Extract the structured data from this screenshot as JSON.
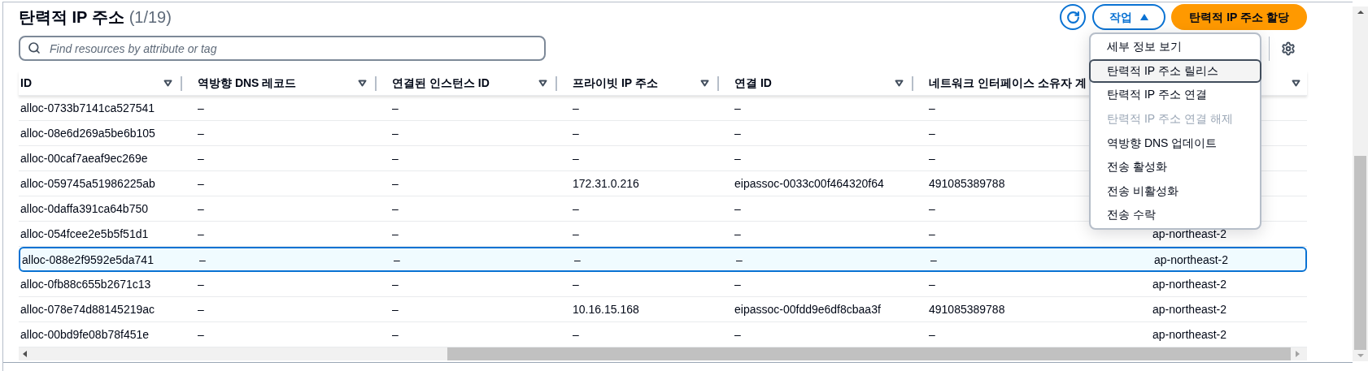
{
  "header": {
    "title": "탄력적 IP 주소",
    "count": "(1/19)"
  },
  "actions_menu": {
    "label": "작업",
    "expanded": true,
    "items": [
      {
        "label": "세부 정보 보기",
        "selected": false,
        "disabled": false
      },
      {
        "label": "탄력적 IP 주소 릴리스",
        "selected": true,
        "disabled": false
      },
      {
        "label": "탄력적 IP 주소 연결",
        "selected": false,
        "disabled": false
      },
      {
        "label": "탄력적 IP 주소 연결 해제",
        "selected": false,
        "disabled": true
      },
      {
        "label": "역방향 DNS 업데이트",
        "selected": false,
        "disabled": false
      },
      {
        "label": "전송 활성화",
        "selected": false,
        "disabled": false
      },
      {
        "label": "전송 비활성화",
        "selected": false,
        "disabled": false
      },
      {
        "label": "전송 수락",
        "selected": false,
        "disabled": false
      }
    ]
  },
  "allocate_button": "탄력적 IP 주소 할당",
  "search": {
    "placeholder": "Find resources by attribute or tag"
  },
  "table": {
    "columns": [
      {
        "label": "ID"
      },
      {
        "label": "역방향 DNS 레코드"
      },
      {
        "label": "연결된 인스턴스 ID"
      },
      {
        "label": "프라이빗 IP 주소"
      },
      {
        "label": "연결 ID"
      },
      {
        "label": "네트워크 인터페이스 소유자 계"
      }
    ],
    "rows": [
      {
        "selected": false,
        "cells": [
          "alloc-0733b7141ca527541",
          "–",
          "–",
          "–",
          "–",
          "–"
        ]
      },
      {
        "selected": false,
        "cells": [
          "alloc-08e6d269a5be6b105",
          "–",
          "–",
          "–",
          "–",
          "–"
        ]
      },
      {
        "selected": false,
        "cells": [
          "alloc-00caf7aeaf9ec269e",
          "–",
          "–",
          "–",
          "–",
          "–"
        ]
      },
      {
        "selected": false,
        "cells": [
          "alloc-059745a51986225ab",
          "–",
          "–",
          "172.31.0.216",
          "eipassoc-0033c00f464320f64",
          "491085389788"
        ]
      },
      {
        "selected": false,
        "cells": [
          "alloc-0daffa391ca64b750",
          "–",
          "–",
          "–",
          "–",
          "–"
        ]
      },
      {
        "selected": false,
        "cells": [
          "alloc-054fcee2e5b5f51d1",
          "–",
          "–",
          "–",
          "–",
          "–",
          "ap-northeast-2"
        ]
      },
      {
        "selected": true,
        "cells": [
          "alloc-088e2f9592e5da741",
          "–",
          "–",
          "–",
          "–",
          "–",
          "ap-northeast-2"
        ]
      },
      {
        "selected": false,
        "cells": [
          "alloc-0fb88c655b2671c13",
          "–",
          "–",
          "–",
          "–",
          "–",
          "ap-northeast-2"
        ]
      },
      {
        "selected": false,
        "cells": [
          "alloc-078e74d88145219ac",
          "–",
          "–",
          "10.16.15.168",
          "eipassoc-00fdd9e6df8cbaa3f",
          "491085389788",
          "ap-northeast-2"
        ]
      },
      {
        "selected": false,
        "cells": [
          "alloc-00bd9fe08b78f451e",
          "–",
          "–",
          "–",
          "–",
          "–",
          "ap-northeast-2"
        ]
      }
    ]
  }
}
